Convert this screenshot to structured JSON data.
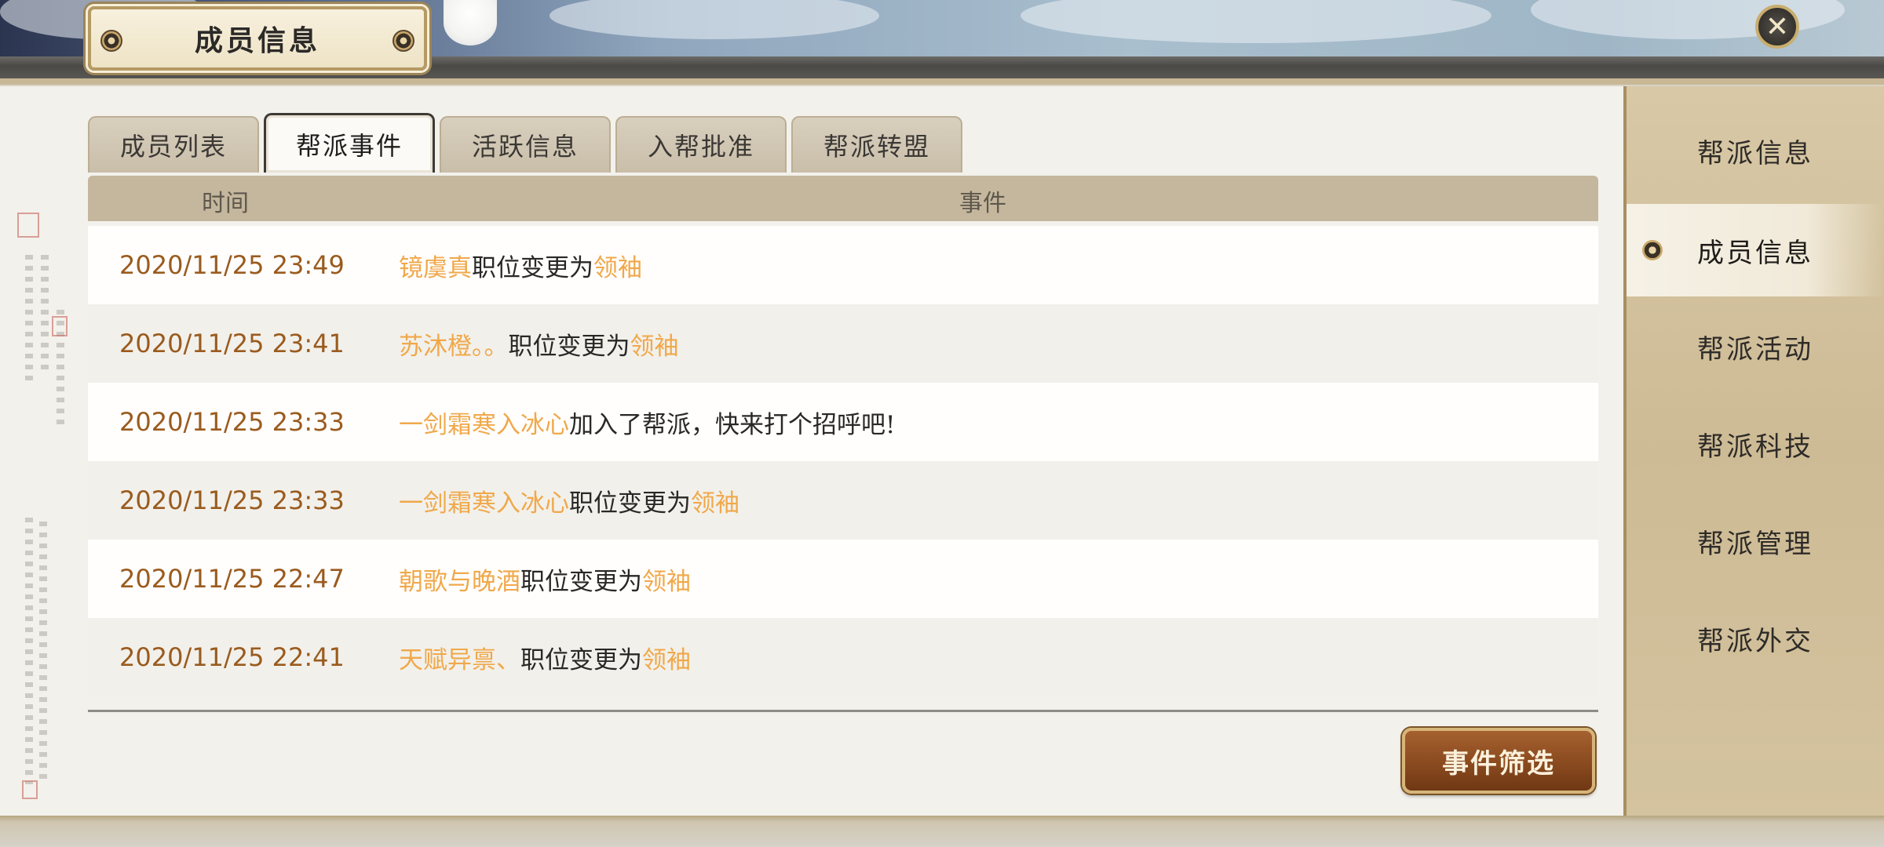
{
  "window": {
    "title": "成员信息",
    "close_icon": "close-icon"
  },
  "tabs": [
    {
      "label": "成员列表",
      "active": false
    },
    {
      "label": "帮派事件",
      "active": true
    },
    {
      "label": "活跃信息",
      "active": false
    },
    {
      "label": "入帮批准",
      "active": false
    },
    {
      "label": "帮派转盟",
      "active": false
    }
  ],
  "table": {
    "headers": {
      "time": "时间",
      "event": "事件"
    },
    "rows": [
      {
        "time": "2020/11/25 23:49",
        "name": "镜虞真",
        "text": "职位变更为",
        "role": "领袖"
      },
      {
        "time": "2020/11/25 23:41",
        "name": "苏沐橙。。",
        "text": "职位变更为",
        "role": "领袖"
      },
      {
        "time": "2020/11/25 23:33",
        "name": "一剑霜寒入冰心",
        "text": "加入了帮派，快来打个招呼吧!",
        "role": ""
      },
      {
        "time": "2020/11/25 23:33",
        "name": "一剑霜寒入冰心",
        "text": "职位变更为",
        "role": "领袖"
      },
      {
        "time": "2020/11/25 22:47",
        "name": "朝歌与晚酒",
        "text": "职位变更为",
        "role": "领袖"
      },
      {
        "time": "2020/11/25 22:41",
        "name": "天赋异禀、",
        "text": "职位变更为",
        "role": "领袖"
      }
    ]
  },
  "filter_button": {
    "label": "事件筛选"
  },
  "sidebar": {
    "items": [
      {
        "label": "帮派信息",
        "active": false
      },
      {
        "label": "成员信息",
        "active": true
      },
      {
        "label": "帮派活动",
        "active": false
      },
      {
        "label": "帮派科技",
        "active": false
      },
      {
        "label": "帮派管理",
        "active": false
      },
      {
        "label": "帮派外交",
        "active": false
      }
    ]
  },
  "colors": {
    "highlight": "#f0a84a",
    "time": "#9a5b1e",
    "button": "#8a4a1f"
  }
}
